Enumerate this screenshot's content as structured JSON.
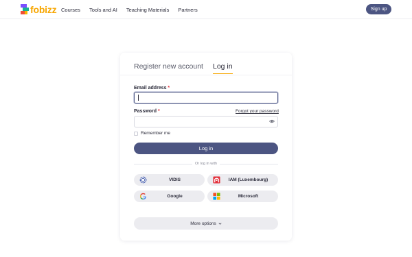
{
  "header": {
    "logo_text": "fobizz",
    "nav": [
      "Courses",
      "Tools and AI",
      "Teaching Materials",
      "Partners"
    ],
    "signup_label": "Sign up"
  },
  "auth": {
    "tabs": [
      {
        "label": "Register new account",
        "active": false
      },
      {
        "label": "Log in",
        "active": true
      }
    ],
    "email_label": "Email address",
    "email_value": "",
    "password_label": "Password",
    "password_value": "",
    "required_mark": "*",
    "forgot_label": "Forgot your password",
    "remember_label": "Remember me",
    "remember_checked": false,
    "login_label": "Log in",
    "or_text": "Or log in with",
    "providers": [
      {
        "label": "VIDIS",
        "icon": "vidis-icon"
      },
      {
        "label": "IAM (Luxembourg)",
        "icon": "iam-luxembourg-icon"
      },
      {
        "label": "Google",
        "icon": "google-icon"
      },
      {
        "label": "Microsoft",
        "icon": "microsoft-icon"
      }
    ],
    "more_options_label": "More options"
  },
  "colors": {
    "primary": "#4c5582",
    "logo": "#f7a600",
    "required": "#e3313c",
    "button_secondary": "#ececf0"
  }
}
